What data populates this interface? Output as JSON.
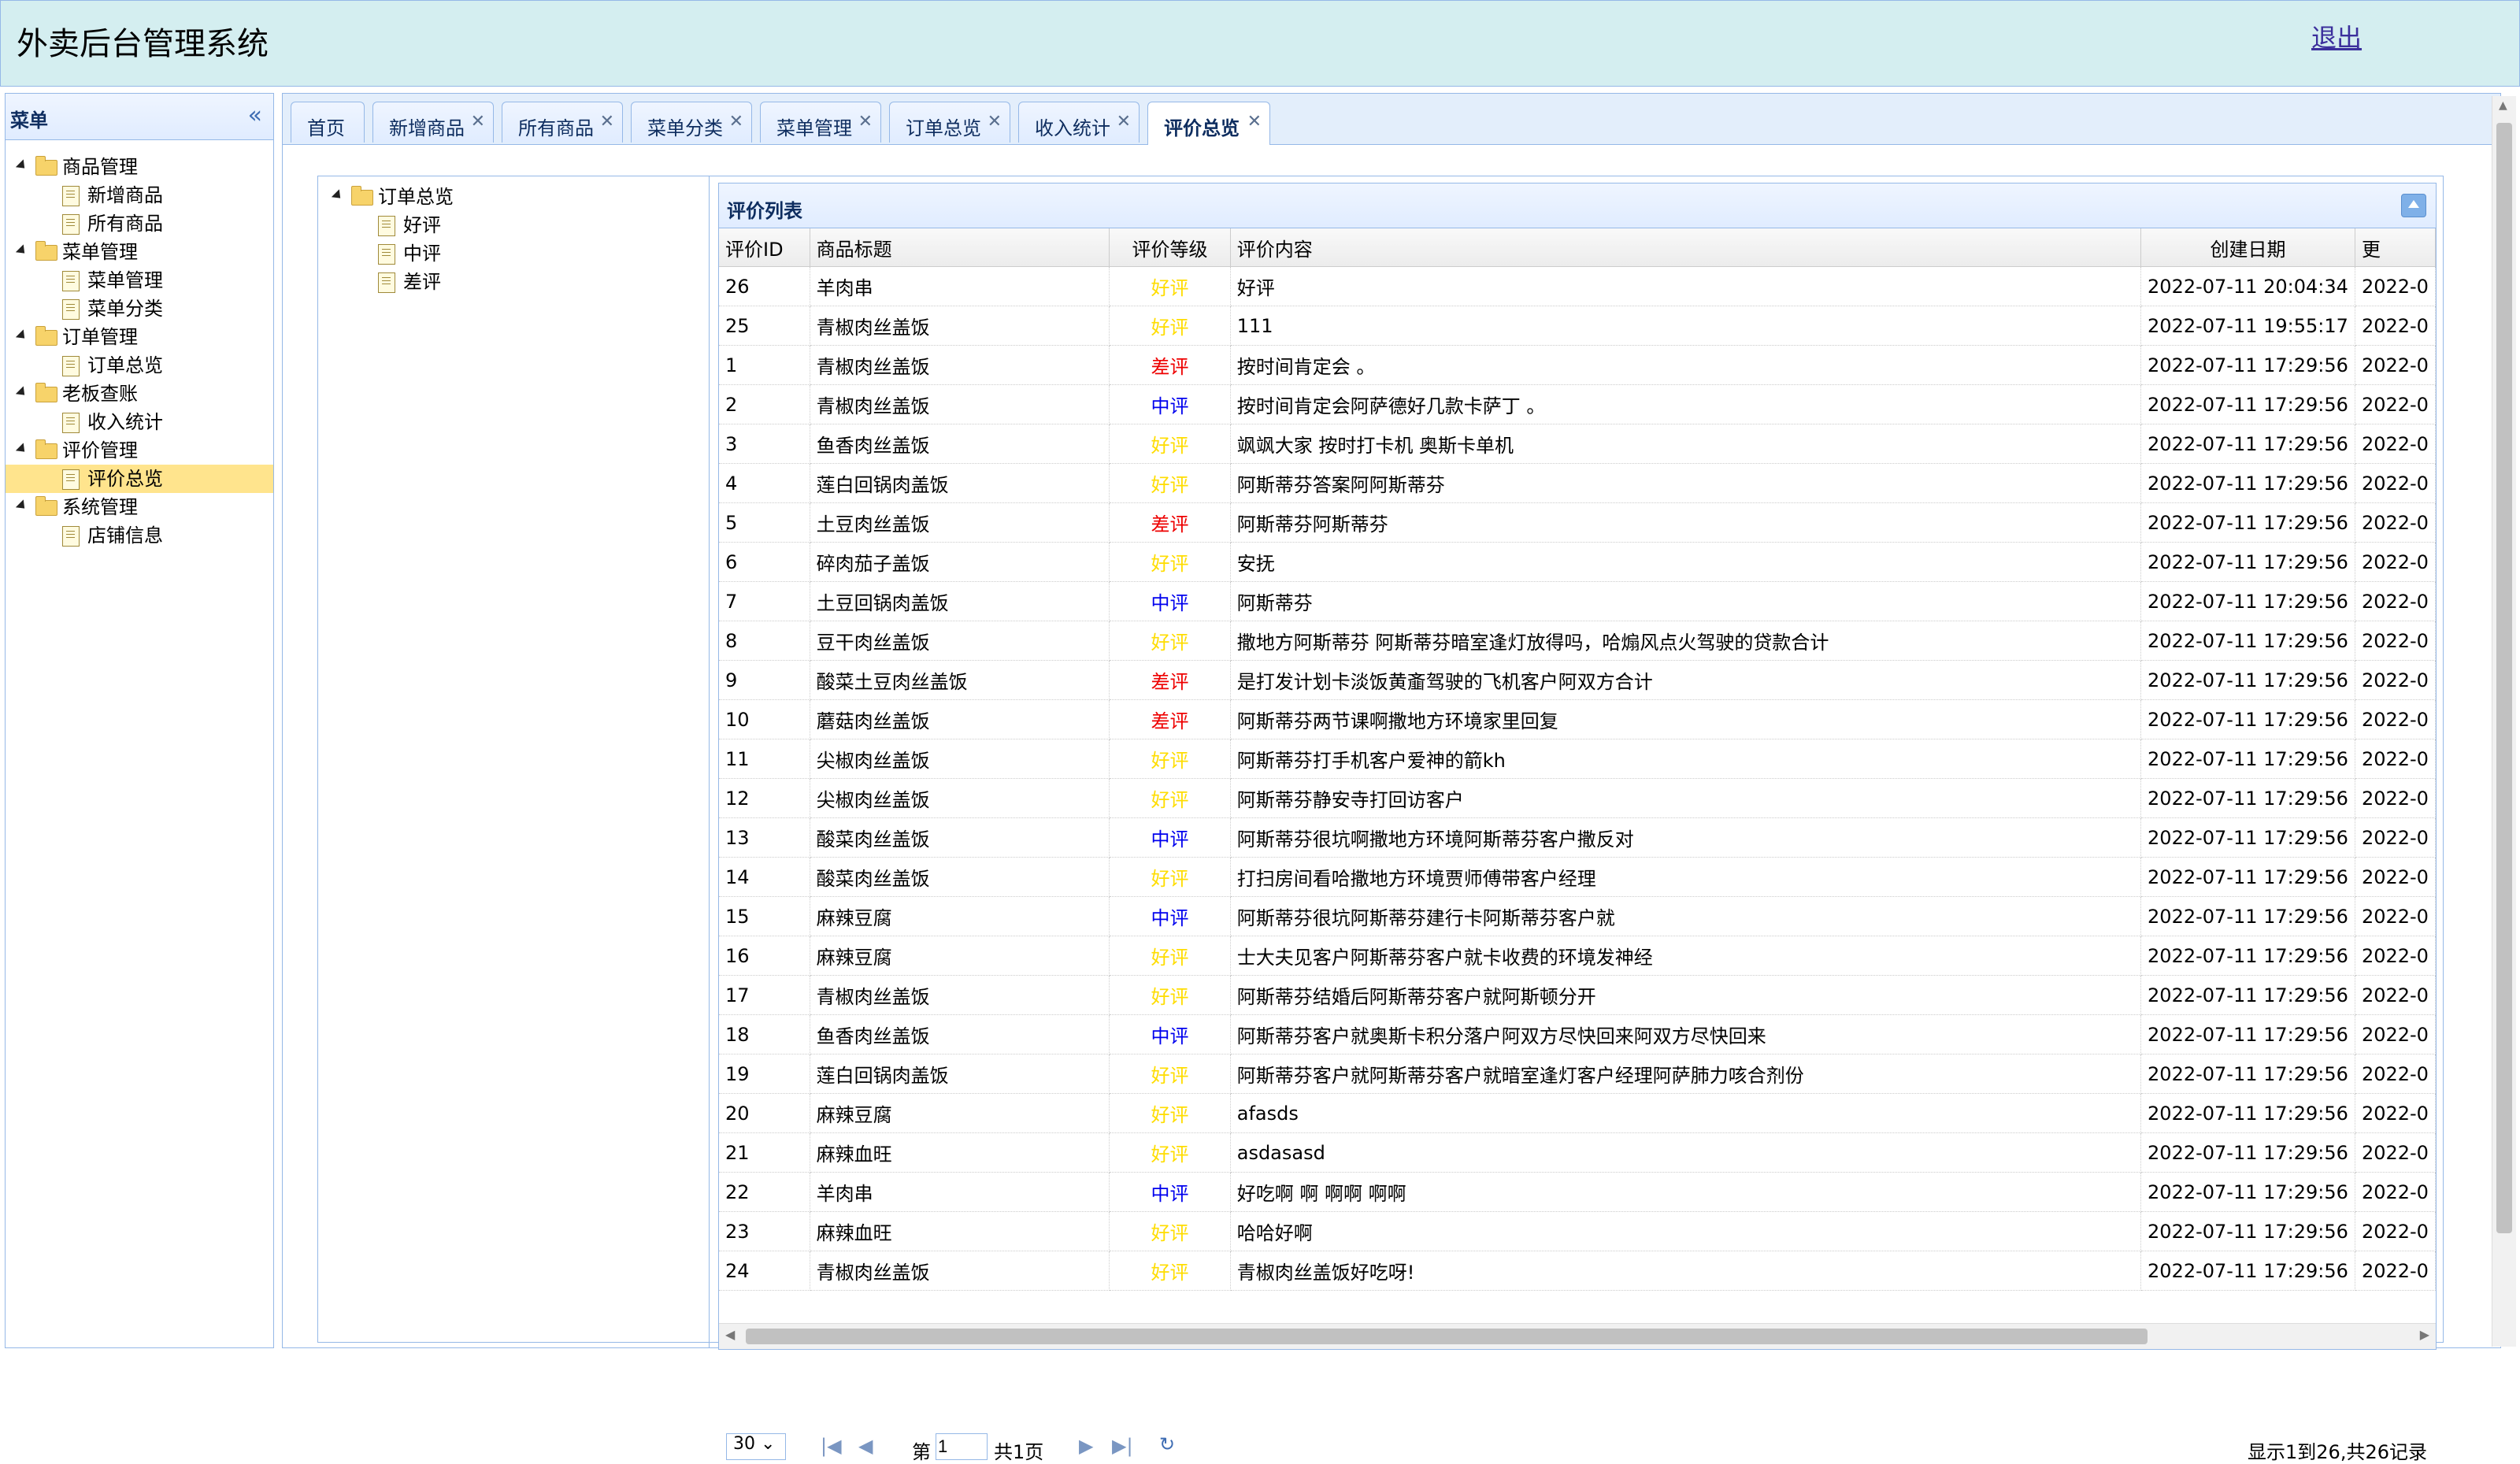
{
  "app": {
    "title": "外卖后台管理系统",
    "logout": "退出"
  },
  "menu": {
    "title": "菜单",
    "collapse_icon": "double-chevron-left-icon",
    "groups": [
      {
        "label": "商品管理",
        "items": [
          {
            "label": "新增商品"
          },
          {
            "label": "所有商品"
          }
        ]
      },
      {
        "label": "菜单管理",
        "items": [
          {
            "label": "菜单管理"
          },
          {
            "label": "菜单分类"
          }
        ]
      },
      {
        "label": "订单管理",
        "items": [
          {
            "label": "订单总览"
          }
        ]
      },
      {
        "label": "老板查账",
        "items": [
          {
            "label": "收入统计"
          }
        ]
      },
      {
        "label": "评价管理",
        "items": [
          {
            "label": "评价总览",
            "selected": true
          }
        ]
      },
      {
        "label": "系统管理",
        "items": [
          {
            "label": "店铺信息"
          }
        ]
      }
    ]
  },
  "tabs": [
    {
      "label": "首页",
      "closable": false
    },
    {
      "label": "新增商品",
      "closable": true
    },
    {
      "label": "所有商品",
      "closable": true
    },
    {
      "label": "菜单分类",
      "closable": true
    },
    {
      "label": "菜单管理",
      "closable": true
    },
    {
      "label": "订单总览",
      "closable": true
    },
    {
      "label": "收入统计",
      "closable": true
    },
    {
      "label": "评价总览",
      "closable": true,
      "active": true
    }
  ],
  "content_tree": {
    "root": "订单总览",
    "children": [
      "好评",
      "中评",
      "差评"
    ]
  },
  "grid": {
    "title": "评价列表",
    "columns": [
      "评价ID",
      "商品标题",
      "评价等级",
      "评价内容",
      "创建日期",
      "更"
    ],
    "rating_colors": {
      "好评": "#ffdd00",
      "中评": "#0000ee",
      "差评": "#ee0000"
    },
    "rows": [
      {
        "id": "26",
        "title": "羊肉串",
        "rating": "好评",
        "content": "好评",
        "created": "2022-07-11 20:04:34",
        "updated": "2022-0"
      },
      {
        "id": "25",
        "title": "青椒肉丝盖饭",
        "rating": "好评",
        "content": "111",
        "created": "2022-07-11 19:55:17",
        "updated": "2022-0"
      },
      {
        "id": "1",
        "title": "青椒肉丝盖饭",
        "rating": "差评",
        "content": "按时间肯定会 。",
        "created": "2022-07-11 17:29:56",
        "updated": "2022-0"
      },
      {
        "id": "2",
        "title": "青椒肉丝盖饭",
        "rating": "中评",
        "content": "按时间肯定会阿萨德好几款卡萨丁 。",
        "created": "2022-07-11 17:29:56",
        "updated": "2022-0"
      },
      {
        "id": "3",
        "title": "鱼香肉丝盖饭",
        "rating": "好评",
        "content": "飒飒大家 按时打卡机 奥斯卡单机",
        "created": "2022-07-11 17:29:56",
        "updated": "2022-0"
      },
      {
        "id": "4",
        "title": "莲白回锅肉盖饭",
        "rating": "好评",
        "content": "阿斯蒂芬答案阿阿斯蒂芬",
        "created": "2022-07-11 17:29:56",
        "updated": "2022-0"
      },
      {
        "id": "5",
        "title": "土豆肉丝盖饭",
        "rating": "差评",
        "content": "阿斯蒂芬阿斯蒂芬",
        "created": "2022-07-11 17:29:56",
        "updated": "2022-0"
      },
      {
        "id": "6",
        "title": "碎肉茄子盖饭",
        "rating": "好评",
        "content": "安抚",
        "created": "2022-07-11 17:29:56",
        "updated": "2022-0"
      },
      {
        "id": "7",
        "title": "土豆回锅肉盖饭",
        "rating": "中评",
        "content": "阿斯蒂芬",
        "created": "2022-07-11 17:29:56",
        "updated": "2022-0"
      },
      {
        "id": "8",
        "title": "豆干肉丝盖饭",
        "rating": "好评",
        "content": "撒地方阿斯蒂芬 阿斯蒂芬暗室逢灯放得吗，哈煽风点火驾驶的贷款合计",
        "created": "2022-07-11 17:29:56",
        "updated": "2022-0"
      },
      {
        "id": "9",
        "title": "酸菜土豆肉丝盖饭",
        "rating": "差评",
        "content": "是打发计划卡淡饭黄齑驾驶的飞机客户阿双方合计",
        "created": "2022-07-11 17:29:56",
        "updated": "2022-0"
      },
      {
        "id": "10",
        "title": "蘑菇肉丝盖饭",
        "rating": "差评",
        "content": "阿斯蒂芬两节课啊撒地方环境家里回复",
        "created": "2022-07-11 17:29:56",
        "updated": "2022-0"
      },
      {
        "id": "11",
        "title": "尖椒肉丝盖饭",
        "rating": "好评",
        "content": "阿斯蒂芬打手机客户爱神的箭kh",
        "created": "2022-07-11 17:29:56",
        "updated": "2022-0"
      },
      {
        "id": "12",
        "title": "尖椒肉丝盖饭",
        "rating": "好评",
        "content": "阿斯蒂芬静安寺打回访客户",
        "created": "2022-07-11 17:29:56",
        "updated": "2022-0"
      },
      {
        "id": "13",
        "title": "酸菜肉丝盖饭",
        "rating": "中评",
        "content": "阿斯蒂芬很坑啊撒地方环境阿斯蒂芬客户撒反对",
        "created": "2022-07-11 17:29:56",
        "updated": "2022-0"
      },
      {
        "id": "14",
        "title": "酸菜肉丝盖饭",
        "rating": "好评",
        "content": "打扫房间看哈撒地方环境贾师傅带客户经理",
        "created": "2022-07-11 17:29:56",
        "updated": "2022-0"
      },
      {
        "id": "15",
        "title": "麻辣豆腐",
        "rating": "中评",
        "content": "阿斯蒂芬很坑阿斯蒂芬建行卡阿斯蒂芬客户就",
        "created": "2022-07-11 17:29:56",
        "updated": "2022-0"
      },
      {
        "id": "16",
        "title": "麻辣豆腐",
        "rating": "好评",
        "content": "士大夫见客户阿斯蒂芬客户就卡收费的环境发神经",
        "created": "2022-07-11 17:29:56",
        "updated": "2022-0"
      },
      {
        "id": "17",
        "title": "青椒肉丝盖饭",
        "rating": "好评",
        "content": "阿斯蒂芬结婚后阿斯蒂芬客户就阿斯顿分开",
        "created": "2022-07-11 17:29:56",
        "updated": "2022-0"
      },
      {
        "id": "18",
        "title": "鱼香肉丝盖饭",
        "rating": "中评",
        "content": "阿斯蒂芬客户就奥斯卡积分落户阿双方尽快回来阿双方尽快回来",
        "created": "2022-07-11 17:29:56",
        "updated": "2022-0"
      },
      {
        "id": "19",
        "title": "莲白回锅肉盖饭",
        "rating": "好评",
        "content": "阿斯蒂芬客户就阿斯蒂芬客户就暗室逢灯客户经理阿萨肺力咳合剂份",
        "created": "2022-07-11 17:29:56",
        "updated": "2022-0"
      },
      {
        "id": "20",
        "title": "麻辣豆腐",
        "rating": "好评",
        "content": "afasds",
        "created": "2022-07-11 17:29:56",
        "updated": "2022-0"
      },
      {
        "id": "21",
        "title": "麻辣血旺",
        "rating": "好评",
        "content": "asdasasd",
        "created": "2022-07-11 17:29:56",
        "updated": "2022-0"
      },
      {
        "id": "22",
        "title": "羊肉串",
        "rating": "中评",
        "content": "好吃啊 啊 啊啊 啊啊",
        "created": "2022-07-11 17:29:56",
        "updated": "2022-0"
      },
      {
        "id": "23",
        "title": "麻辣血旺",
        "rating": "好评",
        "content": "哈哈好啊",
        "created": "2022-07-11 17:29:56",
        "updated": "2022-0"
      },
      {
        "id": "24",
        "title": "青椒肉丝盖饭",
        "rating": "好评",
        "content": "青椒肉丝盖饭好吃呀!",
        "created": "2022-07-11 17:29:56",
        "updated": "2022-0"
      }
    ]
  },
  "pager": {
    "page_size": "30",
    "page_prefix": "第",
    "page_value": "1",
    "page_suffix": "共1页",
    "summary": "显示1到26,共26记录"
  }
}
